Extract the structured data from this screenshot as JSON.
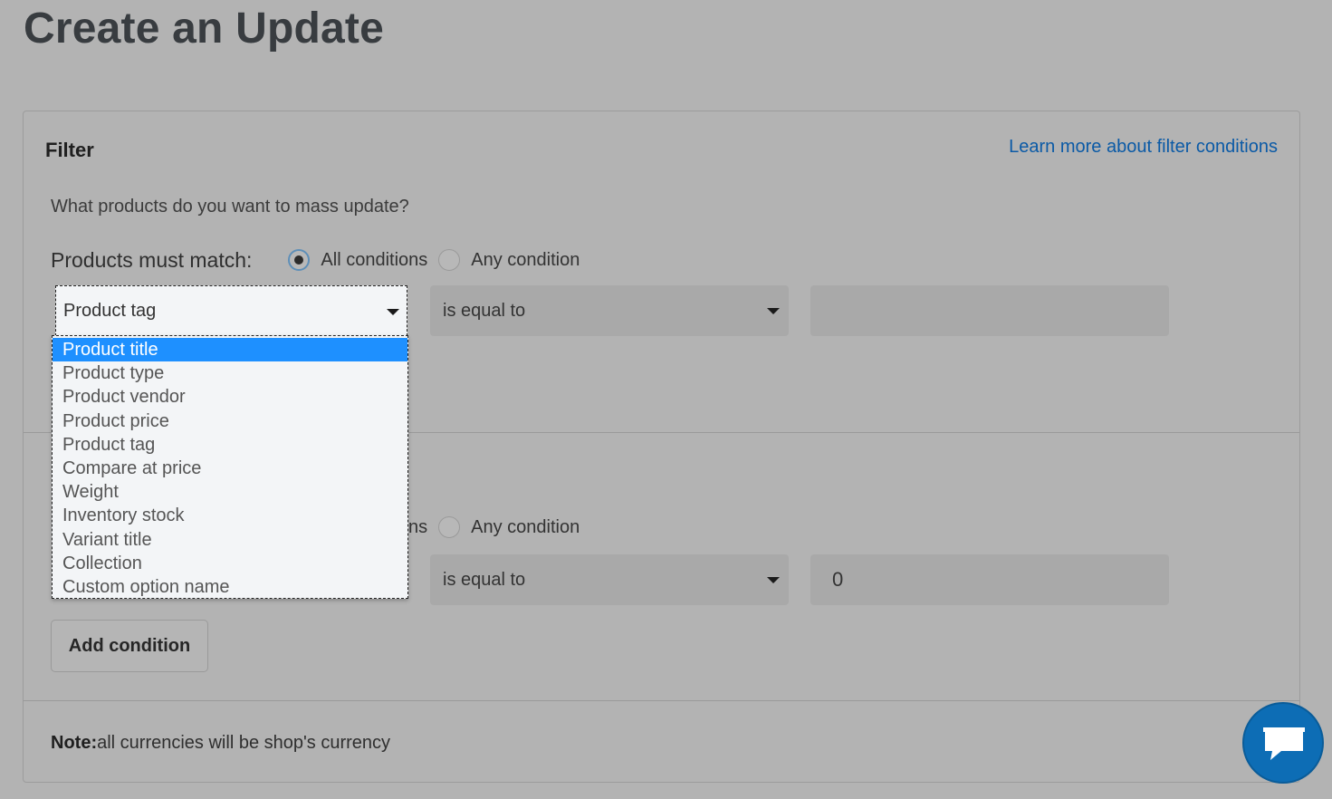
{
  "page": {
    "title": "Create an Update"
  },
  "filter": {
    "heading": "Filter",
    "learn_more": "Learn more about filter conditions",
    "question": "What products do you want to mass update?",
    "match_label": "Products must match:",
    "radio_all": "All conditions",
    "radio_any": "Any condition",
    "row1": {
      "field": "Product tag",
      "operator": "is equal to",
      "value": ""
    },
    "match2_label_fragment": "ns",
    "radio2_any": "Any condition",
    "row2": {
      "operator": "is equal to",
      "value": "0"
    },
    "add_condition": "Add condition",
    "note_bold": "Note:",
    "note_text": "all currencies will be shop's currency"
  },
  "dropdown": {
    "options": [
      "Product title",
      "Product type",
      "Product vendor",
      "Product price",
      "Product tag",
      "Compare at price",
      "Weight",
      "Inventory stock",
      "Variant title",
      "Collection",
      "Custom option name"
    ],
    "highlighted": "Product title"
  },
  "chat": {
    "icon": "chat-bubble-icon"
  }
}
